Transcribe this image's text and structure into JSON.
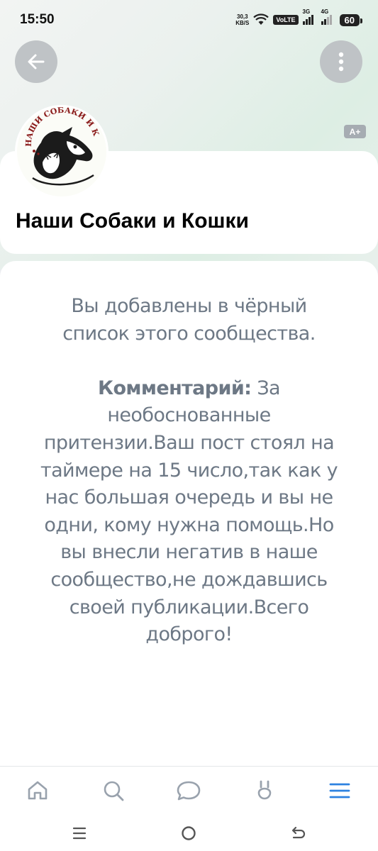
{
  "status_bar": {
    "time": "15:50",
    "net_speed_value": "30,3",
    "net_speed_unit": "KB/S",
    "volte": "VoLTE",
    "sim1_label": "3G",
    "sim2_label": "4G",
    "battery": "60"
  },
  "header": {
    "back_icon": "arrow-left-icon",
    "more_icon": "vertical-dots-icon",
    "font_size_badge": "A+",
    "logo_text": "НАШИ СОБАКИ И КОШКИ",
    "group_name": "Наши Собаки и Кошки"
  },
  "message": {
    "line1": "Вы добавлены в чёрный список этого сообщества.",
    "comment_label": "Комментарий:",
    "comment_text": " За необоснованные притензии.Ваш пост стоял на таймере на 15 число,так как у нас большая очередь и вы не одни, кому нужна помощь.Но вы внесли негатив в наше сообщество,не дождавшись своей публикации.Всего доброго!"
  },
  "tab_bar": {
    "items": [
      "home-icon",
      "search-icon",
      "messages-icon",
      "services-icon",
      "menu-icon"
    ],
    "active": "menu-icon",
    "active_color": "#2d81e0",
    "inactive_color": "#99a2ad"
  },
  "system_nav": [
    "recents-icon",
    "home-circle-icon",
    "back-icon"
  ]
}
